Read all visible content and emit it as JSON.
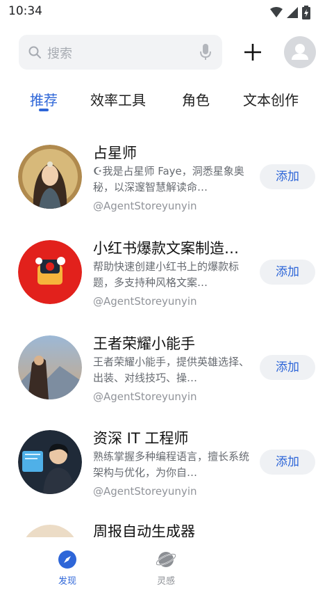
{
  "status_bar": {
    "time": "10:34"
  },
  "search": {
    "placeholder": "搜索"
  },
  "tabs": [
    {
      "label": "推荐",
      "active": true
    },
    {
      "label": "效率工具",
      "active": false
    },
    {
      "label": "角色",
      "active": false
    },
    {
      "label": "文本创作",
      "active": false
    }
  ],
  "items": [
    {
      "title": "占星师",
      "description": "☪我是占星师 Faye，洞悉星象奥秘，以深邃智慧解读命…",
      "author": "@AgentStoreyunyin",
      "button": "添加"
    },
    {
      "title": "小红书爆款文案制造…",
      "description": "帮助快速创建小红书上的爆款标题，多支持种风格文案…",
      "author": "@AgentStoreyunyin",
      "button": "添加"
    },
    {
      "title": "王者荣耀小能手",
      "description": "王者荣耀小能手，提供英雄选择、出装、对线技巧、操…",
      "author": "@AgentStoreyunyin",
      "button": "添加"
    },
    {
      "title": "资深 IT 工程师",
      "description": "熟练掌握多种编程语言，擅长系统架构与优化，为你自…",
      "author": "@AgentStoreyunyin",
      "button": "添加"
    }
  ],
  "partial_item": {
    "title": "周报自动生成器"
  },
  "bottom_nav": [
    {
      "label": "发现",
      "icon": "compass-icon",
      "active": true
    },
    {
      "label": "灵感",
      "icon": "planet-icon",
      "active": false
    }
  ],
  "colors": {
    "accent": "#2e66d8",
    "button_bg": "#eff1f4",
    "search_bg": "#f2f3f5"
  }
}
